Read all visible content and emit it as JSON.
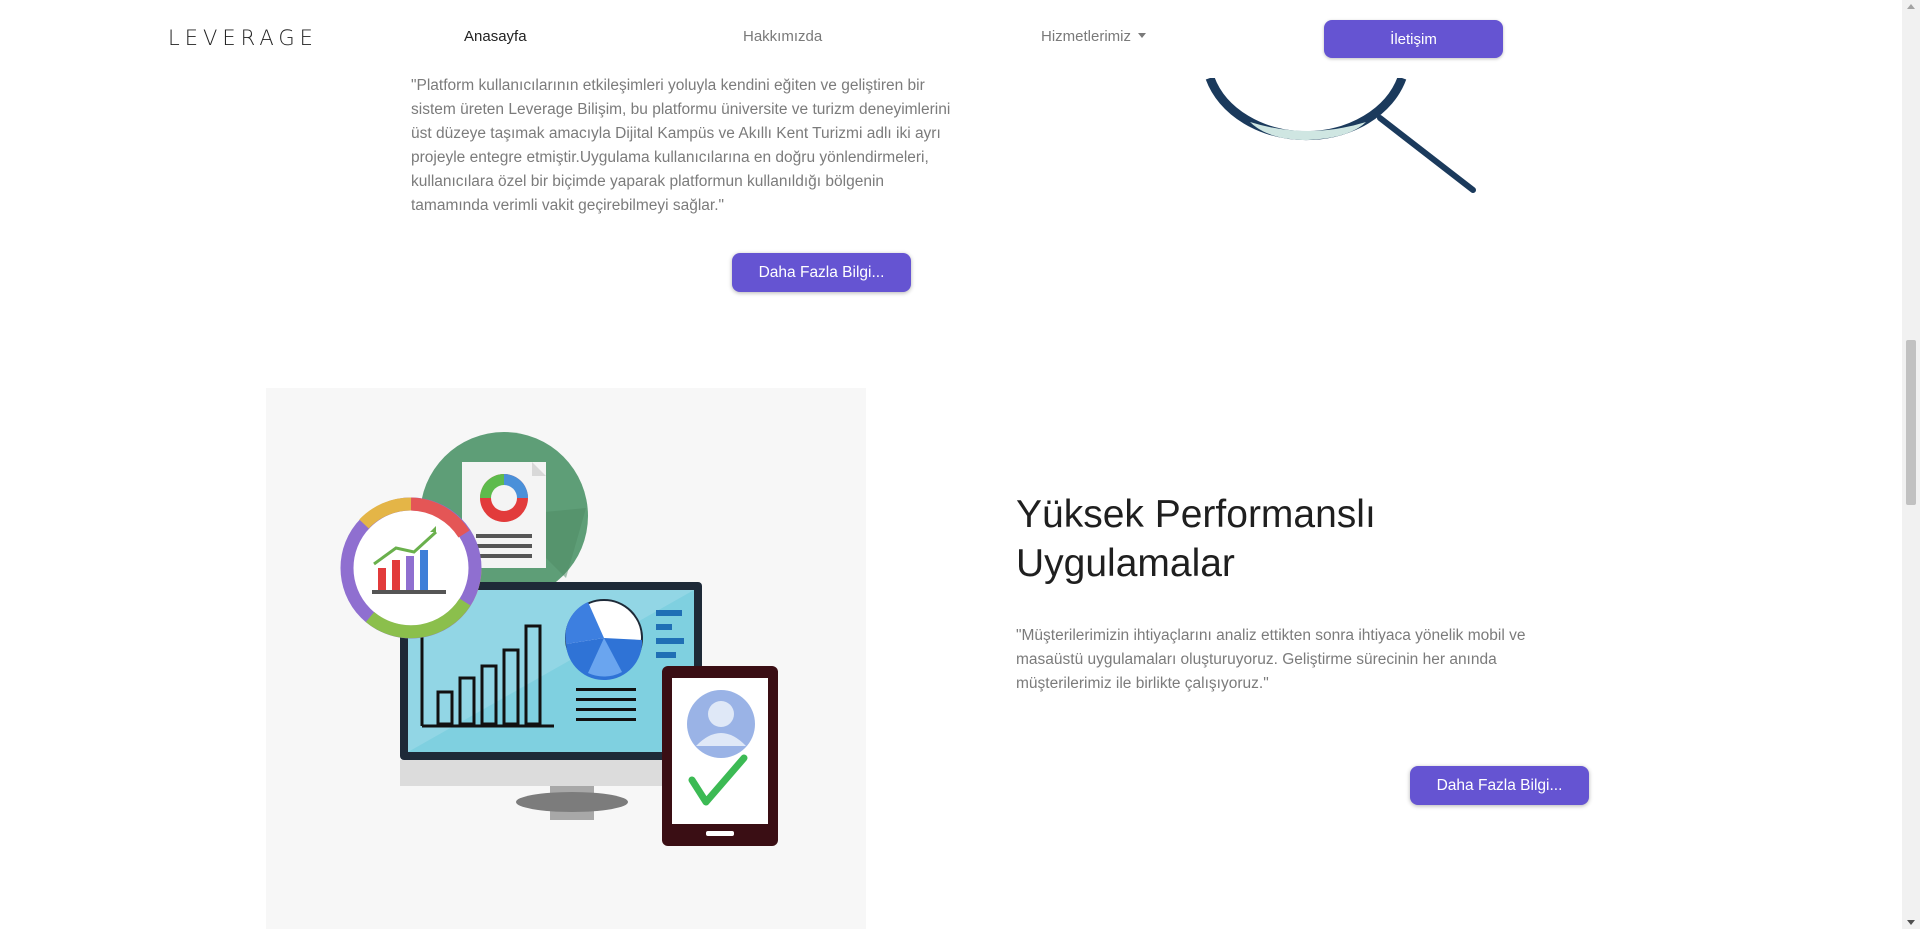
{
  "navbar": {
    "brand": "LEVERAGE",
    "home": "Anasayfa",
    "about": "Hakkımızda",
    "services": "Hizmetlerimiz",
    "contact": "İletişim"
  },
  "section1": {
    "text": "\"Platform kullanıcılarının etkileşimleri yoluyla kendini eğiten ve geliştiren bir sistem üreten Leverage Bilişim, bu platformu üniversite ve turizm deneyimlerini üst düzeye taşımak amacıyla Dijital Kampüs ve Akıllı Kent Turizmi adlı iki ayrı projeyle entegre etmiştir.Uygulama kullanıcılarına en doğru yönlendirmeleri, kullanıcılara özel bir biçimde yaparak platformun kullanıldığı bölgenin tamamında verimli vakit geçirebilmeyi sağlar.\"",
    "button": "Daha Fazla Bilgi..."
  },
  "section2": {
    "title": "Yüksek Performanslı Uygulamalar",
    "text": "\"Müşterilerimizin ihtiyaçlarını analiz ettikten sonra ihtiyaca yönelik mobil ve masaüstü uygulamaları oluşturuyoruz. Geliştirme sürecinin her anında müşterilerimiz ile birlikte çalışıyoruz.\"",
    "button": "Daha Fazla Bilgi..."
  },
  "colors": {
    "accent": "#6554d2",
    "text_muted": "#7b7b7b",
    "heading": "#1f1f1f",
    "magnifier": "#1b3a5c"
  },
  "icons": [
    "dropdown-caret-icon",
    "magnifier-illustration",
    "analytics-illustration",
    "checkmark-icon",
    "user-avatar-icon"
  ]
}
